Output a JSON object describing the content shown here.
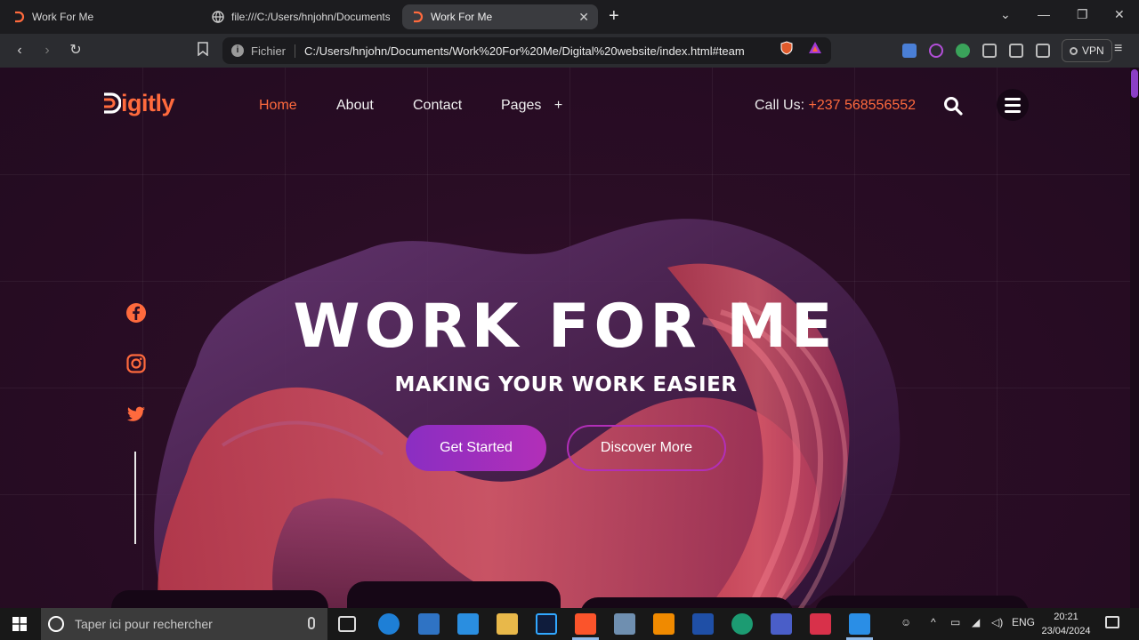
{
  "browser": {
    "tabs": [
      {
        "label": "Work For Me",
        "active": false
      },
      {
        "label": "file:///C:/Users/hnjohn/Documents/W",
        "active": false
      },
      {
        "label": "Work For Me",
        "active": true
      }
    ],
    "new_tab": "+",
    "address": {
      "scheme_label": "Fichier",
      "url": "C:/Users/hnjohn/Documents/Work%20For%20Me/Digital%20website/index.html#team"
    },
    "vpn_label": "VPN"
  },
  "site": {
    "logo_text": "igitly",
    "nav": [
      {
        "label": "Home",
        "active": true
      },
      {
        "label": "About",
        "active": false
      },
      {
        "label": "Contact",
        "active": false
      },
      {
        "label": "Pages",
        "active": false
      }
    ],
    "pages_plus": "+",
    "call_label": "Call Us:",
    "call_number": "+237 568556552",
    "social": [
      "facebook-icon",
      "instagram-icon",
      "twitter-icon"
    ],
    "hero": {
      "title": "WORK FOR ME",
      "subtitle": "MAKING YOUR WORK EASIER",
      "primary_button": "Get Started",
      "secondary_button": "Discover More"
    },
    "accent": "#ff6a3d",
    "purple": "#b22fb8"
  },
  "taskbar": {
    "search_placeholder": "Taper ici pour rechercher",
    "language": "ENG",
    "time": "20:21",
    "date": "23/04/2024"
  }
}
